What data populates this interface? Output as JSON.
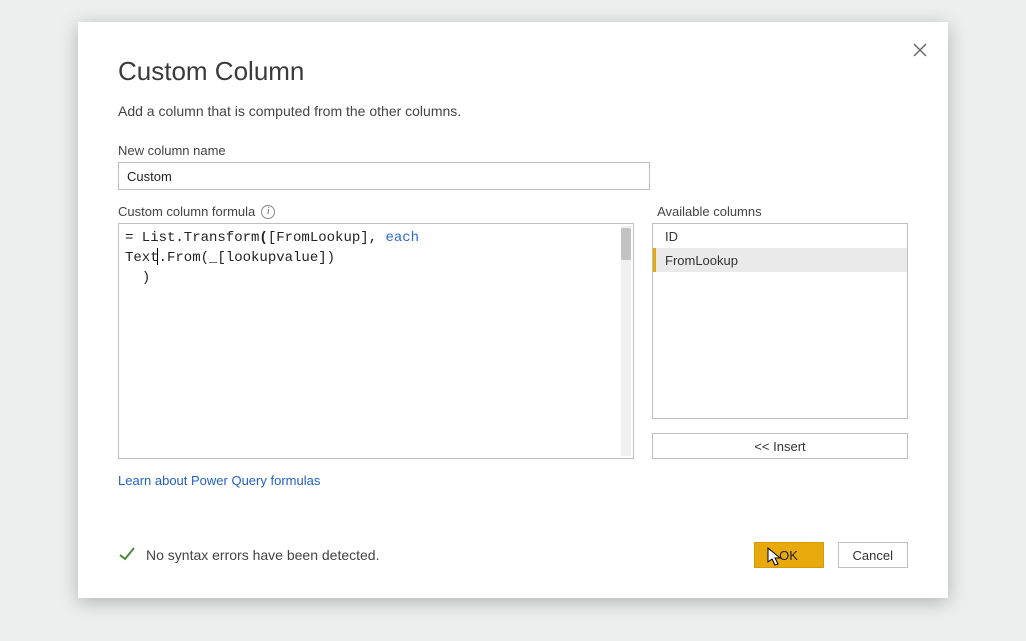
{
  "dialog": {
    "title": "Custom Column",
    "subtitle": "Add a column that is computed from the other columns.",
    "close_name": "close-icon"
  },
  "column_name": {
    "label": "New column name",
    "value": "Custom"
  },
  "formula": {
    "label": "Custom column formula",
    "line1_prefix": "= List.Transform",
    "line1_paren_open": "(",
    "line1_arg": "[FromLookup], ",
    "line1_keyword": "each",
    "line1_rest": " Text.From(_[lookupvalue])",
    "line2": "  )"
  },
  "available": {
    "label": "Available columns",
    "items": [
      {
        "label": "ID",
        "selected": false
      },
      {
        "label": "FromLookup",
        "selected": true
      }
    ],
    "insert_label": "<< Insert"
  },
  "learn_link": "Learn about Power Query formulas",
  "status": {
    "text": "No syntax errors have been detected."
  },
  "buttons": {
    "ok": "OK",
    "cancel": "Cancel"
  }
}
